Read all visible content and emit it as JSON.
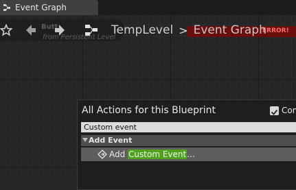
{
  "tab": {
    "label": "Event Graph"
  },
  "ghost": {
    "node_label": "Event",
    "error_text": "ERROR!",
    "button_text": "Butt",
    "persistent_text": "from Persistent Level"
  },
  "breadcrumb": {
    "level": "TempLevel",
    "separator": ">",
    "graph": "Event Graph"
  },
  "menu": {
    "title": "All Actions for this Blueprint",
    "context_label": "Con",
    "context_checked": true,
    "search_value": "Custom event",
    "category": "Add Event",
    "item_prefix": "Add ",
    "item_highlight": "Custom Event",
    "item_suffix": "..."
  }
}
